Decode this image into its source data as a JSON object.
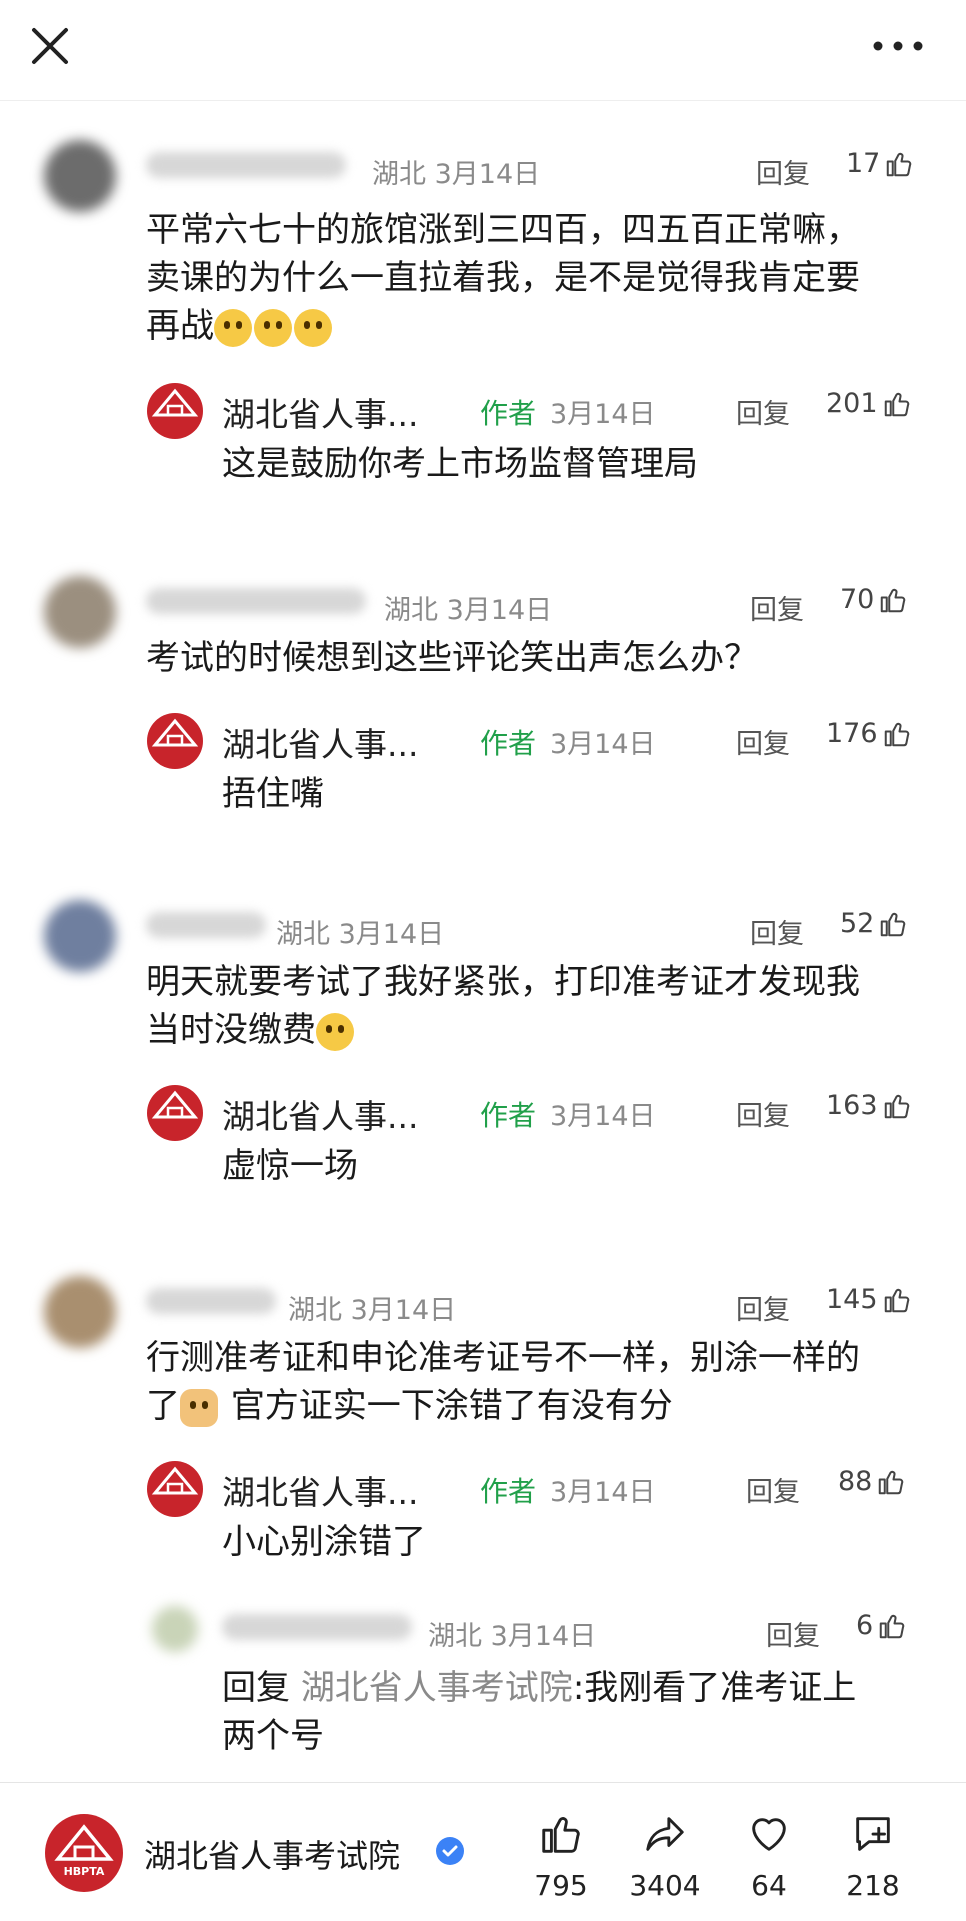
{
  "topbar": {
    "close_icon": "close-icon",
    "more_icon": "more-dots-icon"
  },
  "comments": [
    {
      "location": "湖北",
      "date": "3月14日",
      "reply_label": "回复",
      "likes": "17",
      "lines": [
        "平常六七十的旅馆涨到三四百，四五百正常嘛，",
        "卖课的为什么一直拉着我，是不是觉得我肯定要",
        "再战"
      ],
      "emoji": "😳😳😳",
      "author_reply": {
        "name": "湖北省人事...",
        "tag": "作者",
        "date": "3月14日",
        "reply_label": "回复",
        "likes": "201",
        "text": "这是鼓励你考上市场监督管理局"
      }
    },
    {
      "location": "湖北",
      "date": "3月14日",
      "reply_label": "回复",
      "likes": "70",
      "lines": [
        "考试的时候想到这些评论笑出声怎么办？"
      ],
      "author_reply": {
        "name": "湖北省人事...",
        "tag": "作者",
        "date": "3月14日",
        "reply_label": "回复",
        "likes": "176",
        "text": "捂住嘴"
      }
    },
    {
      "location": "湖北",
      "date": "3月14日",
      "reply_label": "回复",
      "likes": "52",
      "lines": [
        "明天就要考试了我好紧张，打印准考证才发现我",
        "当时没缴费"
      ],
      "emoji": "🙂",
      "author_reply": {
        "name": "湖北省人事...",
        "tag": "作者",
        "date": "3月14日",
        "reply_label": "回复",
        "likes": "163",
        "text": "虚惊一场"
      }
    },
    {
      "location": "湖北",
      "date": "3月14日",
      "reply_label": "回复",
      "likes": "145",
      "lines": [
        "行测准考证和申论准考证号不一样，别涂一样的",
        "官方证实一下涂错了有没有分"
      ],
      "line2_prefix": "了",
      "emoji": "🐶",
      "author_reply": {
        "name": "湖北省人事...",
        "tag": "作者",
        "date": "3月14日",
        "reply_label": "回复",
        "likes": "88",
        "text": "小心别涂错了"
      },
      "sub_reply": {
        "location": "湖北",
        "date": "3月14日",
        "reply_label": "回复",
        "likes": "6",
        "prefix": "回复 ",
        "target": "湖北省人事考试院",
        "line1": ":我刚看了准考证上",
        "line2": "两个号"
      }
    }
  ],
  "footer": {
    "account_name": "湖北省人事考试院",
    "logo_text": "HBPTA",
    "verified_icon": "verified-badge-icon",
    "stats": [
      {
        "icon": "thumbs-up-icon",
        "value": "795"
      },
      {
        "icon": "share-icon",
        "value": "3404"
      },
      {
        "icon": "heart-icon",
        "value": "64"
      },
      {
        "icon": "comment-add-icon",
        "value": "218"
      }
    ]
  },
  "colors": {
    "author_tag": "#21a04a",
    "logo_red": "#c8242b",
    "verified_blue": "#3b82f6"
  }
}
